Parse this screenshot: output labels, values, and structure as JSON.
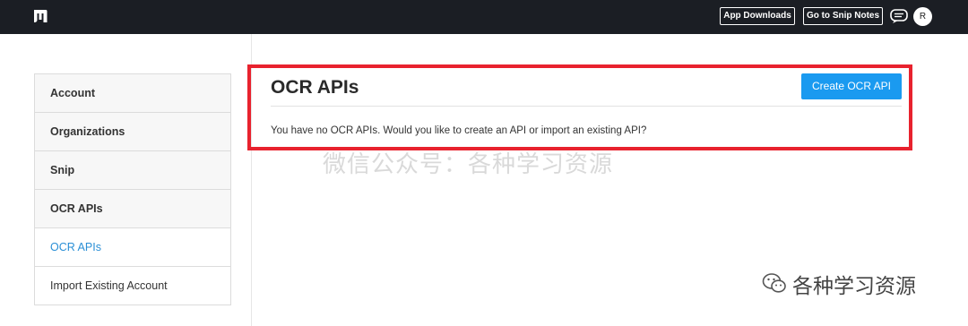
{
  "topbar": {
    "logo_icon": "mathpix-logo-icon",
    "app_downloads_label": "App Downloads",
    "snip_notes_label": "Go to Snip Notes",
    "chat_icon": "chat-icon",
    "avatar_initial": "R"
  },
  "sidebar": {
    "items": [
      {
        "label": "Account"
      },
      {
        "label": "Organizations"
      },
      {
        "label": "Snip"
      },
      {
        "label": "OCR APIs"
      },
      {
        "label": "OCR APIs"
      },
      {
        "label": "Import Existing Account"
      }
    ]
  },
  "main": {
    "title": "OCR APIs",
    "create_button_label": "Create OCR API",
    "empty_message": "You have no OCR APIs. Would you like to create an API or import an existing API?"
  },
  "watermark": {
    "center_text": "微信公众号：各种学习资源",
    "corner_text": "各种学习资源",
    "corner_icon": "wechat-icon"
  },
  "colors": {
    "topbar_bg": "#1b1e24",
    "accent": "#1a9af0",
    "link_active": "#2a8fd6",
    "highlight_border": "#e8222e"
  }
}
